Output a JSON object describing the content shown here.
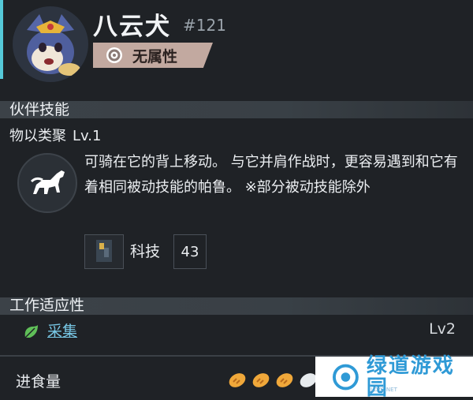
{
  "pal": {
    "name": "八云犬",
    "number": "#121",
    "element": {
      "label": "无属性",
      "icon": "neutral-element-icon",
      "color": "#c2a9a0"
    }
  },
  "partner_skill": {
    "section_title": "伙伴技能",
    "name": "物以类聚",
    "level": "Lv.1",
    "icon": "horse-icon",
    "description": "可骑在它的背上移动。 与它并肩作战时，更容易遇到和它有着相同被动技能的帕鲁。 ※部分被动技能除外",
    "requirement": {
      "label": "科技",
      "value": "43",
      "icon": "tech-item-icon"
    }
  },
  "work_suitability": {
    "section_title": "工作适应性",
    "items": [
      {
        "label": "采集",
        "level": "Lv2",
        "icon": "leaf-icon"
      }
    ]
  },
  "food": {
    "label": "进食量",
    "icon": "bread-icon"
  },
  "watermark": {
    "text": "绿道游戏园",
    "sub": "LDYC.NET"
  },
  "colors": {
    "background": "#1f2226",
    "accent": "#55c9d8",
    "link": "#78c8e6"
  }
}
